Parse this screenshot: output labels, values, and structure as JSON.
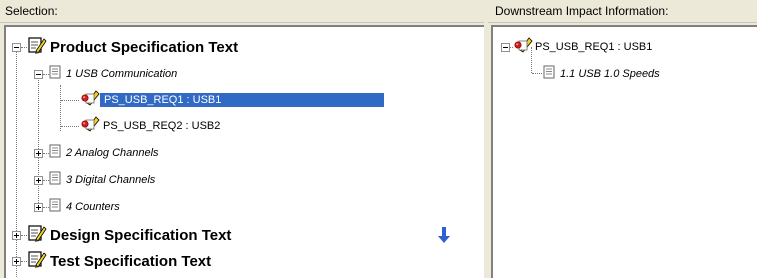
{
  "left_pane": {
    "header": "Selection:",
    "specs": [
      {
        "label": "Product Specification   Text",
        "expanded": true
      },
      {
        "label": "Design Specification   Text",
        "expanded": false
      },
      {
        "label": "Test Specification   Text",
        "expanded": false
      }
    ],
    "sections": [
      {
        "label": "1 USB Communication",
        "expanded": true
      },
      {
        "label": "2 Analog Channels",
        "expanded": false
      },
      {
        "label": "3 Digital Channels",
        "expanded": false
      },
      {
        "label": "4 Counters",
        "expanded": false
      }
    ],
    "requirements": [
      {
        "label": "PS_USB_REQ1 : USB1",
        "selected": true
      },
      {
        "label": "PS_USB_REQ2 : USB2",
        "selected": false
      }
    ]
  },
  "right_pane": {
    "header": "Downstream Impact Information:",
    "root": {
      "label": "PS_USB_REQ1 : USB1",
      "expanded": true
    },
    "children": [
      {
        "label": "1.1 USB 1.0 Speeds"
      }
    ]
  },
  "colors": {
    "selection": "#316ac5",
    "background": "#ece9d8",
    "arrow": "#2f5fd0"
  },
  "icons": {
    "spec": "spec-document-pencil-icon",
    "section": "document-page-icon",
    "requirement": "requirement-pin-icon",
    "scroll": "down-arrow-icon"
  }
}
